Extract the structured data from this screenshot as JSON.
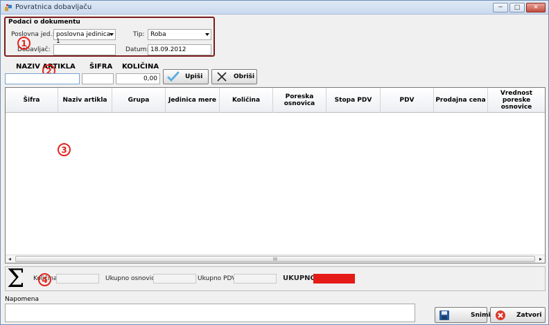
{
  "window": {
    "title": "Povratnica dobavljaču",
    "min": "─",
    "max": "□",
    "close": "✕"
  },
  "doc_group": {
    "title": "Podaci o dokumentu",
    "poslovna_label": "Poslovna jed.:",
    "poslovna_value": "poslovna jedinica 1",
    "tip_label": "Tip:",
    "tip_value": "Roba",
    "dobavljac_label": "Dobavljač:",
    "dobavljac_value": "",
    "datum_label": "Datum:",
    "datum_value": "18.09.2012"
  },
  "entry": {
    "naziv_label": "NAZIV ARTIKLA",
    "sifra_label": "ŠIFRA",
    "kolicina_label": "KOLIČINA",
    "naziv_value": "",
    "sifra_value": "",
    "kolicina_value": "0,00",
    "upisi_label": "Upiši",
    "obrisi_label": "Obriši"
  },
  "grid": {
    "columns": [
      "Šifra",
      "Naziv artikla",
      "Grupa",
      "Jedinica mere",
      "Količina",
      "Poreska osnovica",
      "Stopa PDV",
      "PDV",
      "Prodajna cena",
      "Vrednost poreske osnovice"
    ],
    "rows": [],
    "scroll_thumb": "III"
  },
  "summary": {
    "sigma": "Σ",
    "kolicina_label": "Količina:",
    "osnovica_label": "Ukupno osnovica:",
    "pdv_label": "Ukupno PDV:",
    "ukupno_label": "UKUPNO:"
  },
  "napomena": {
    "label": "Napomena",
    "value": ""
  },
  "buttons": {
    "snimi": "Snimi",
    "zatvori": "Zatvori"
  },
  "markers": [
    "1",
    "2",
    "3",
    "4"
  ],
  "colors": {
    "marker_red": "#e2231a",
    "group_border": "#7b1b1b",
    "ukupno_fill": "#e41b17"
  }
}
